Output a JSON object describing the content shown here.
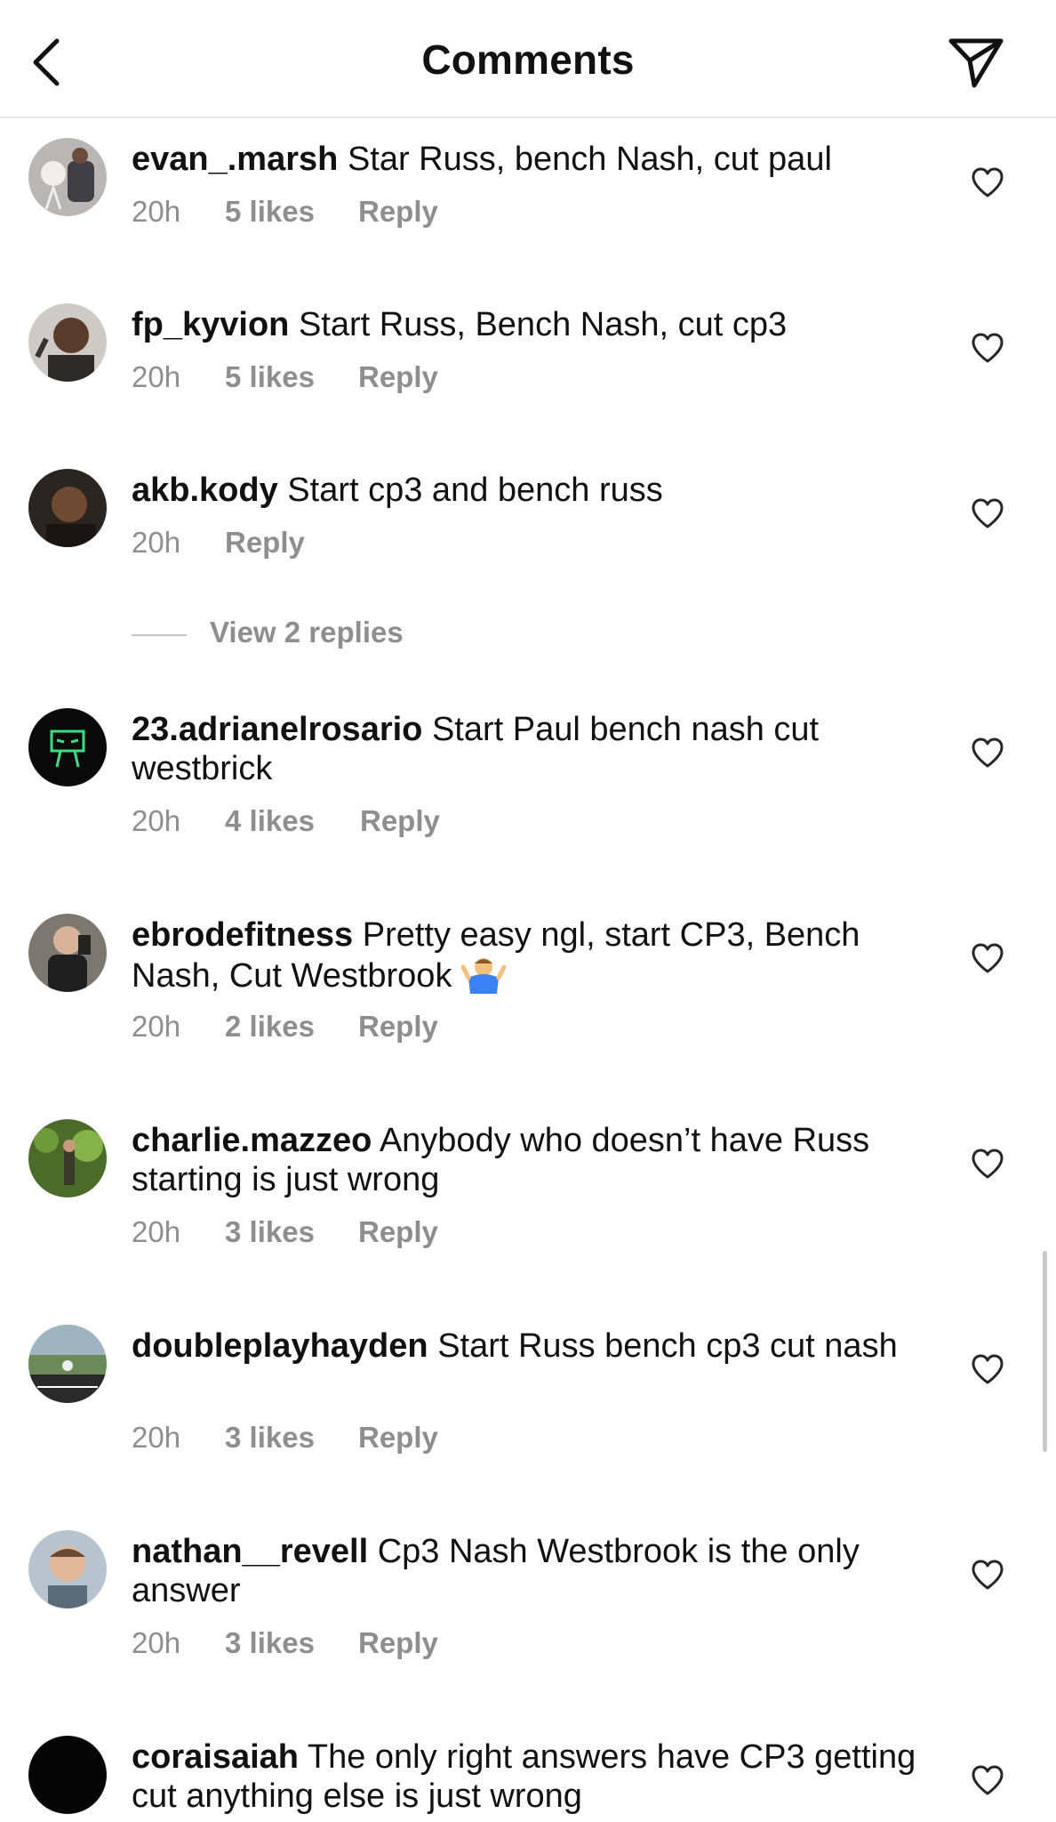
{
  "header": {
    "title": "Comments",
    "back_icon": "chevron-left-icon",
    "send_icon": "paper-plane-icon"
  },
  "comments": [
    {
      "user": "evan_.marsh",
      "text": "Star Russ, bench Nash, cut paul",
      "time": "20h",
      "likes": "5 likes",
      "reply": "Reply"
    },
    {
      "user": "fp_kyvion",
      "text": "Start Russ, Bench Nash, cut cp3",
      "time": "20h",
      "likes": "5 likes",
      "reply": "Reply"
    },
    {
      "user": "akb.kody",
      "text": "Start cp3 and bench russ",
      "time": "20h",
      "reply": "Reply"
    },
    {
      "user": "23.adrianelrosario",
      "text": "Start Paul bench nash cut westbrick",
      "time": "20h",
      "likes": "4 likes",
      "reply": "Reply"
    },
    {
      "user": "ebrodefitness",
      "text": "Pretty easy ngl, start CP3, Bench Nash, Cut Westbrook",
      "emoji": "person-shrugging-emoji",
      "time": "20h",
      "likes": "2 likes",
      "reply": "Reply"
    },
    {
      "user": "charlie.mazzeo",
      "text": "Anybody who doesn’t have Russ starting is just wrong",
      "time": "20h",
      "likes": "3 likes",
      "reply": "Reply"
    },
    {
      "user": "doubleplayhayden",
      "text": "Start Russ bench cp3 cut nash",
      "time": "20h",
      "likes": "3 likes",
      "reply": "Reply"
    },
    {
      "user": "nathan__revell",
      "text": "Cp3 Nash Westbrook is the only answer",
      "time": "20h",
      "likes": "3 likes",
      "reply": "Reply"
    },
    {
      "user": "coraisaiah",
      "text": "The only right answers have CP3 getting cut anything else is just wrong"
    }
  ],
  "view_replies": "View 2 replies",
  "colors": {
    "text": "#111111",
    "secondary": "#8e8e8e",
    "divider": "#e9e9e9"
  }
}
